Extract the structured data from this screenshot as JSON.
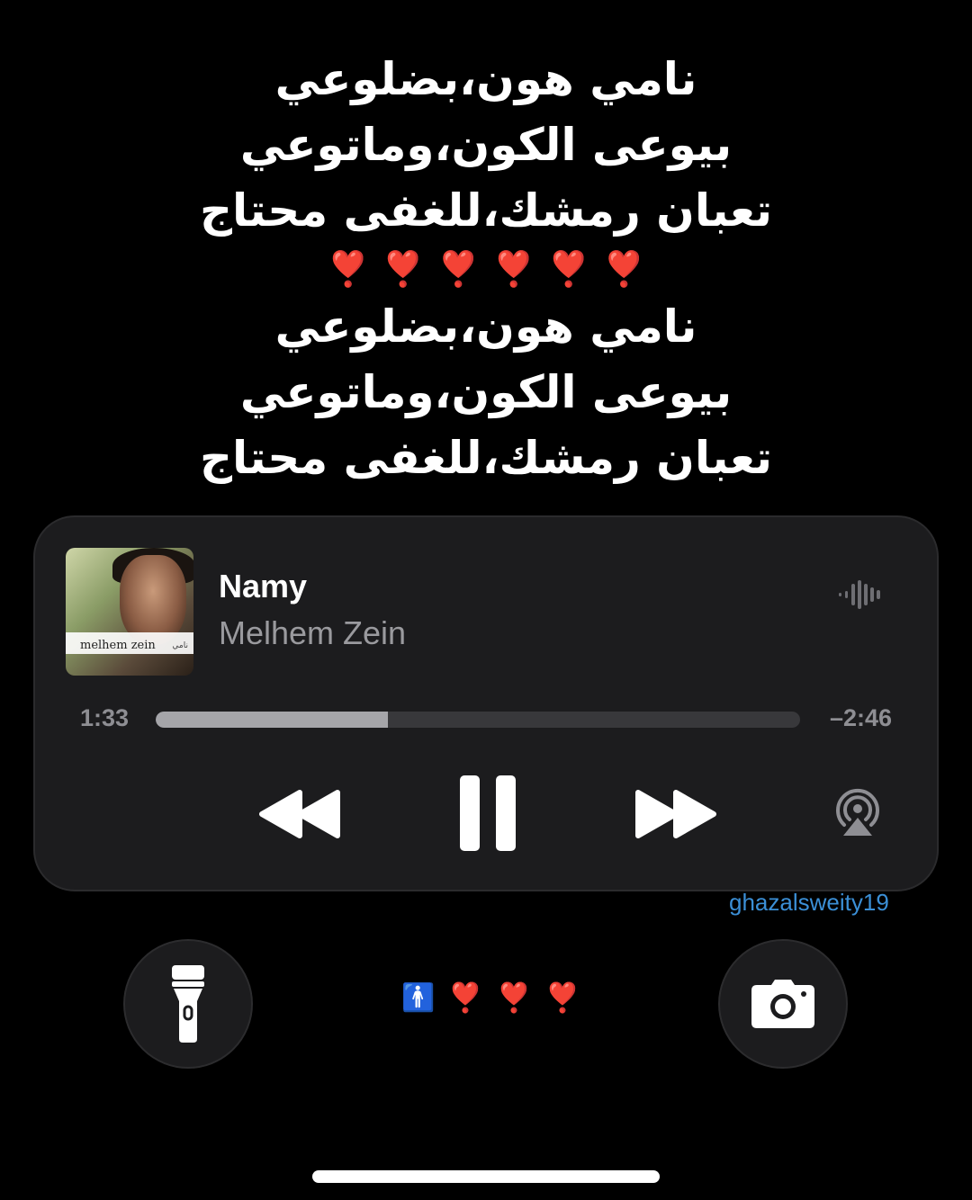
{
  "lyrics": {
    "lines_top": [
      "نامي هون،بضلوعي",
      "بيوعى الكون،وماتوعي",
      "تعبان رمشك،للغفى محتاج"
    ],
    "hearts": [
      "❣️",
      "❣️",
      "❣️",
      "❣️",
      "❣️",
      "❣️"
    ],
    "lines_bottom": [
      "نامي هون،بضلوعي",
      "بيوعى الكون،وماتوعي",
      "تعبان رمشك،للغفى محتاج"
    ]
  },
  "player": {
    "title": "Namy",
    "artist": "Melhem Zein",
    "album_art_text": "melhem zein",
    "album_art_subtext": "نامي",
    "elapsed": "1:33",
    "remaining": "–2:46",
    "progress_fraction": 0.36,
    "icons": [
      "waveform-icon",
      "rewind-icon",
      "pause-icon",
      "fast-forward-icon",
      "airplay-icon"
    ]
  },
  "watermark": "ghazalsweity19",
  "lock_screen": {
    "status_icons": [
      "🚹",
      "❣️",
      "❣️",
      "❣️"
    ],
    "left_button_icon": "flashlight-icon",
    "right_button_icon": "camera-icon"
  },
  "colors": {
    "background": "#000000",
    "player_bg": "#1c1c1e",
    "progress_fill": "#a5a5a9",
    "watermark": "#3b8fd6",
    "heart": "#e0142c"
  }
}
